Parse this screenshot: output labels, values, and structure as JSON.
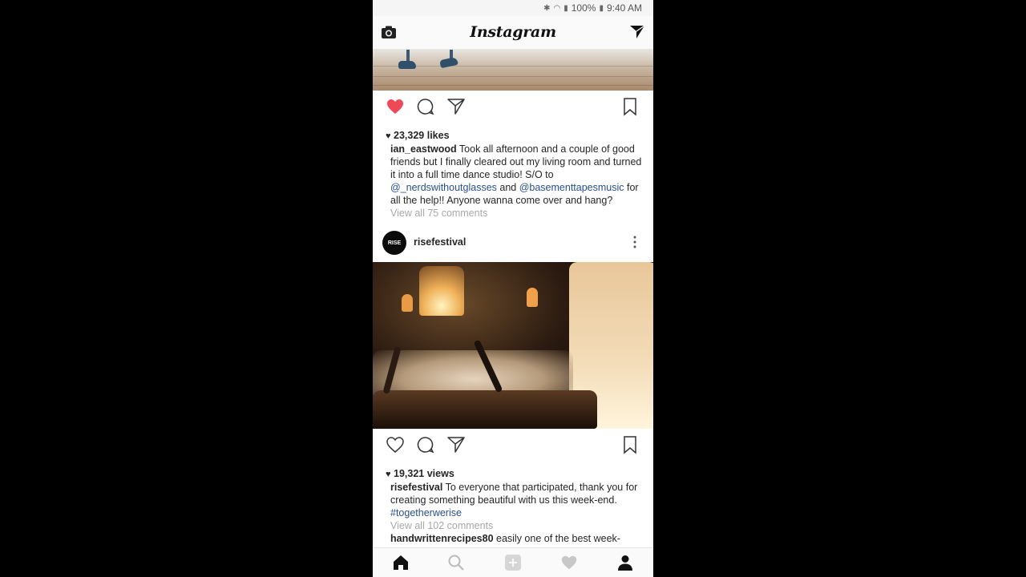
{
  "status": {
    "signal": "100%",
    "time": "9:40 AM"
  },
  "app": {
    "title": "Instagram"
  },
  "post1": {
    "likes": "23,329 likes",
    "username": "ian_eastwood",
    "caption_a": " Took all afternoon and a couple of good friends but I finally cleared out my living room and turned it into a full time dance studio!     S/O to ",
    "mention1": "@_nerdswithoutglasses",
    "caption_b": " and ",
    "mention2": "@basementtapesmusic",
    "caption_c": " for all the help!! Anyone wanna come over and hang?",
    "view_comments": "View all 75 comments"
  },
  "post2": {
    "username": "risefestival",
    "avatar_text": "RISE",
    "views": "19,321 views",
    "caption_a": " To everyone that participated, thank you for creating something beautiful with us this week-end. ",
    "hashtag": "#togetherwerise",
    "view_comments": "View all 102 comments",
    "comment_user": "handwrittenrecipes80",
    "comment_text": " easily one of the best week-"
  },
  "colors": {
    "like_red": "#ed4956",
    "link_blue": "#2a4f8f",
    "muted": "#a8a8a8"
  }
}
